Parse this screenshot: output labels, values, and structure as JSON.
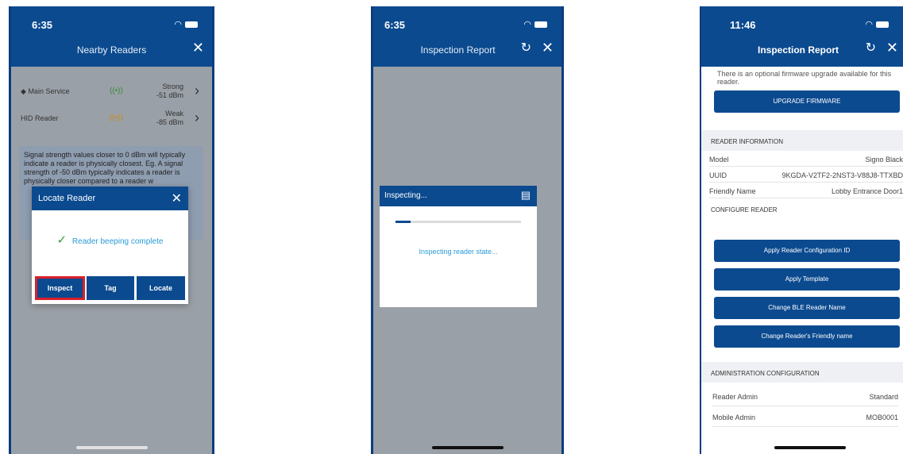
{
  "screen1": {
    "time": "6:35",
    "title": "Nearby Readers",
    "readers": [
      {
        "name": "Main Service",
        "signal_icon": "((•))",
        "strength": "Strong",
        "dbm": "-51 dBm"
      },
      {
        "name": "HID Reader",
        "signal_icon": "((•))",
        "strength": "Weak",
        "dbm": "-85 dBm"
      }
    ],
    "info_text": "Signal strength values closer to 0 dBm will typically indicate a reader is physically closest. Eg. A signal strength of -50 dBm typically indicates a reader is physically closer compared to a reader w",
    "dialog": {
      "title": "Locate Reader",
      "message": "Reader beeping complete",
      "buttons": {
        "inspect": "Inspect",
        "tag": "Tag",
        "locate": "Locate"
      }
    },
    "colors": {
      "primary": "#0b4a8f",
      "highlight": "#d91f2a",
      "success": "#3a9b3a"
    }
  },
  "screen2": {
    "time": "6:35",
    "title": "Inspection Report",
    "dialog_title": "Inspecting...",
    "status": "Inspecting reader state...",
    "progress": 0.12
  },
  "screen3": {
    "time": "11:46",
    "title": "Inspection Report",
    "firmware_note": "There is an optional firmware upgrade available for this reader.",
    "upgrade_button": "UPGRADE FIRMWARE",
    "reader_info_header": "READER INFORMATION",
    "reader_info": [
      {
        "label": "Model",
        "value": "Signo Black"
      },
      {
        "label": "UUID",
        "value": "9KGDA-V2TF2-2NST3-V88J8-TTXBD"
      },
      {
        "label": "Friendly Name",
        "value": "Lobby Entrance Door1"
      }
    ],
    "configure_header": "CONFIGURE READER",
    "configure_buttons": [
      "Apply Reader Configuration ID",
      "Apply Template",
      "Change BLE Reader Name",
      "Change Reader's Friendly name"
    ],
    "admin_header": "ADMINISTRATION CONFIGURATION",
    "admin": [
      {
        "label": "Reader Admin",
        "value": "Standard"
      },
      {
        "label": "Mobile Admin",
        "value": "MOB0001"
      }
    ]
  }
}
